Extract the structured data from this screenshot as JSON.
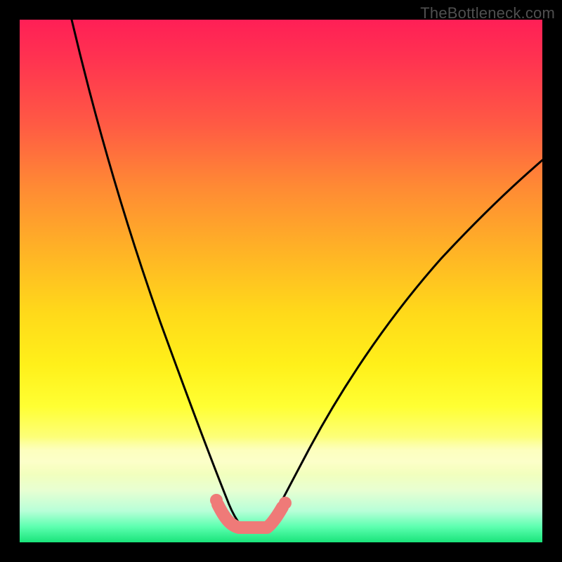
{
  "watermark": "TheBottleneck.com",
  "chart_data": {
    "type": "line",
    "title": "",
    "xlabel": "",
    "ylabel": "",
    "xlim": [
      0,
      100
    ],
    "ylim": [
      0,
      100
    ],
    "grid": false,
    "legend": false,
    "series": [
      {
        "name": "left-curve",
        "color": "#000000",
        "x": [
          10,
          15,
          20,
          25,
          30,
          33,
          36,
          38,
          40,
          42
        ],
        "y": [
          100,
          82,
          63,
          45,
          28,
          17,
          10,
          6,
          4,
          3
        ]
      },
      {
        "name": "right-curve",
        "color": "#000000",
        "x": [
          48,
          50,
          53,
          58,
          65,
          75,
          85,
          95,
          100
        ],
        "y": [
          3,
          5,
          9,
          16,
          26,
          40,
          52,
          62,
          67
        ]
      },
      {
        "name": "pink-valley-highlight",
        "color": "#ef7a78",
        "x": [
          38,
          40,
          42,
          45,
          48,
          50
        ],
        "y": [
          7,
          4,
          3,
          3,
          3,
          6
        ]
      }
    ],
    "annotations": [
      {
        "type": "point",
        "name": "pink-dot-left",
        "x": 38,
        "y": 7,
        "color": "#ef7a78"
      },
      {
        "type": "point",
        "name": "pink-dot-right",
        "x": 50,
        "y": 6,
        "color": "#ef7a78"
      }
    ]
  }
}
